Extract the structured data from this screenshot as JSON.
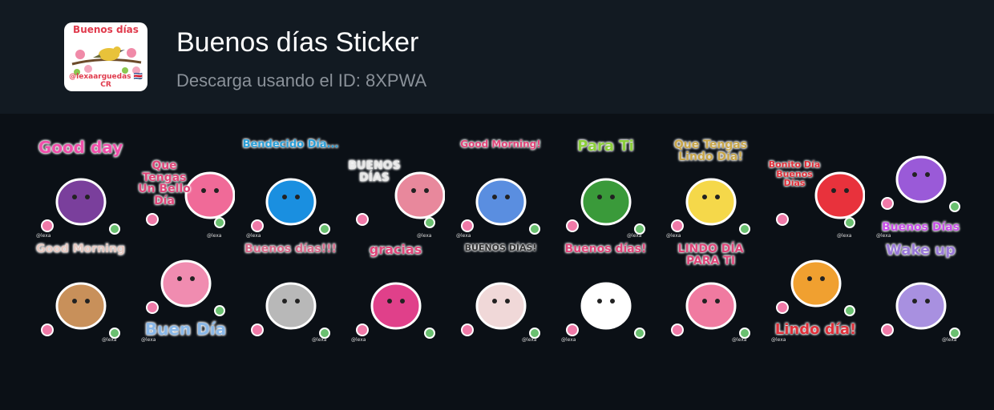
{
  "header": {
    "pack_icon": {
      "top_text": "Buenos días",
      "bottom_text": "@lexaarguedas 🇨🇷 CR",
      "icon": "bird-on-flowering-branch"
    },
    "title": "Buenos días Sticker",
    "subtitle": "Descarga usando el ID: 8XPWA"
  },
  "stickers": [
    {
      "text": "Good day",
      "pos": "top",
      "color": "#f04faa",
      "size": 20,
      "bg": "#7a3f9c",
      "shape": "bird-icon"
    },
    {
      "text": "Que Tengas Un Bello Día",
      "pos": "mid",
      "color": "#e0467a",
      "size": 14,
      "bg": "#f06a98",
      "shape": "heart-icon"
    },
    {
      "text": "Bendecido Día...",
      "pos": "top",
      "color": "#2a9fd8",
      "size": 13,
      "bg": "#1a8fe0",
      "shape": "butterfly-icon"
    },
    {
      "text": "BUENOS DÍAS",
      "pos": "mid",
      "color": "#e8e8e8",
      "size": 14,
      "bg": "#e8889c",
      "shape": "tulip-icon"
    },
    {
      "text": "Good Morning!",
      "pos": "top",
      "color": "#e0467a",
      "size": 12,
      "bg": "#5a8ee0",
      "shape": "bluebird-icon"
    },
    {
      "text": "Para Ti",
      "pos": "top",
      "color": "#8ccf3c",
      "size": 18,
      "bg": "#3a9a3a",
      "shape": "frog-icon"
    },
    {
      "text": "Que Tengas Lindo Día!",
      "pos": "top",
      "color": "#c8a64a",
      "size": 14,
      "bg": "#f5d84a",
      "shape": "duckling-icon"
    },
    {
      "text": "Bonito Día Buenos Días",
      "pos": "mid",
      "color": "#e0303a",
      "size": 11,
      "bg": "#e8323c",
      "shape": "strawberry-icon"
    },
    {
      "text": "Buenos Días",
      "pos": "bot",
      "color": "#c84ee8",
      "size": 14,
      "bg": "#9a5ad8",
      "shape": "owl-icon"
    },
    {
      "text": "Good Morning",
      "pos": "top",
      "color": "#e7c9c1",
      "size": 14,
      "bg": "#c8905a",
      "shape": "puppy-teacup-icon"
    },
    {
      "text": "Buen Día",
      "pos": "bot",
      "color": "#8ab8e8",
      "size": 20,
      "bg": "#f08cb0",
      "shape": "hummingbird-icon"
    },
    {
      "text": "Buenos días!!!",
      "pos": "top",
      "color": "#d86a8a",
      "size": 14,
      "bg": "#b8b8b8",
      "shape": "bunny-icon"
    },
    {
      "text": "gracias",
      "pos": "top",
      "color": "#e0467a",
      "size": 16,
      "bg": "#e0408a",
      "shape": "flowers-icon"
    },
    {
      "text": "BUENOS DÍAS!",
      "pos": "top",
      "color": "#333333",
      "size": 11,
      "bg": "#f0d8d8",
      "shape": "bunny-face-icon"
    },
    {
      "text": "Buenos días!",
      "pos": "top",
      "color": "#e0467a",
      "size": 14,
      "bg": "#ffffff",
      "shape": "rabbit-wreath-icon"
    },
    {
      "text": "LINDO DÍA PARA TI",
      "pos": "top",
      "color": "#e0467a",
      "size": 14,
      "bg": "#f07aa0",
      "shape": "high-heel-icon"
    },
    {
      "text": "Lindo día!",
      "pos": "bot",
      "color": "#e0303a",
      "size": 18,
      "bg": "#f0a030",
      "shape": "ladybug-icon"
    },
    {
      "text": "Wake up",
      "pos": "top",
      "color": "#9a7ad8",
      "size": 18,
      "bg": "#a890e0",
      "shape": "owl-purple-icon"
    }
  ],
  "credit": "@lexa"
}
